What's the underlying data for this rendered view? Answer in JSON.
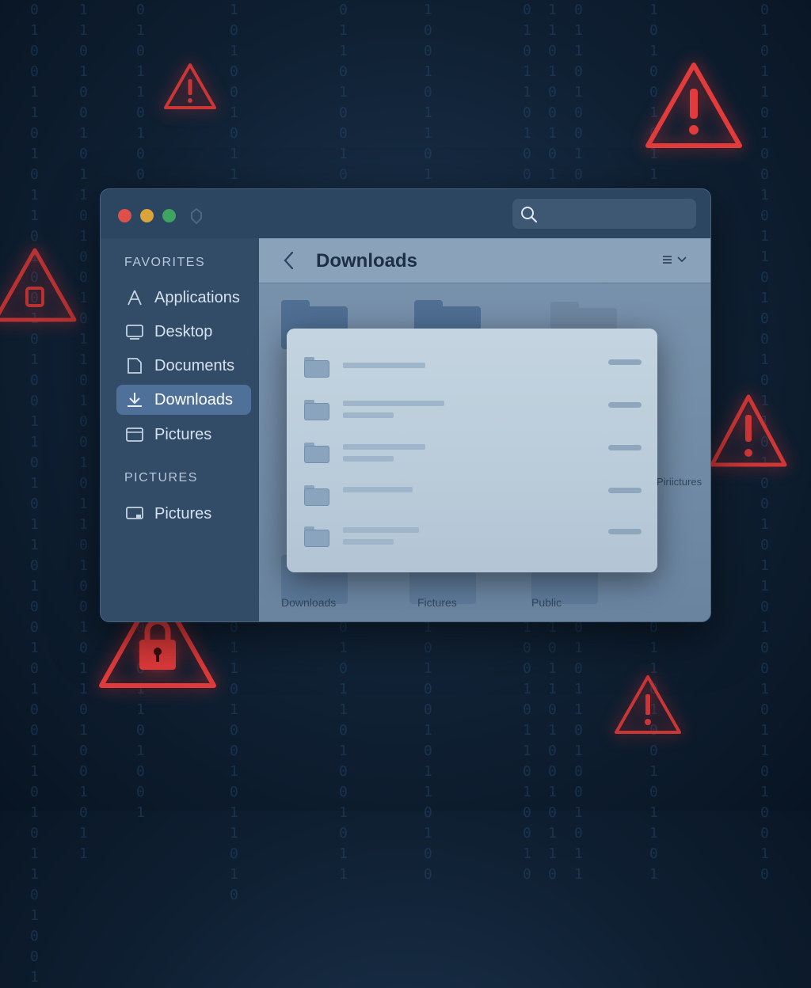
{
  "window": {
    "search_placeholder": "",
    "traffic_lights": [
      "#e0504a",
      "#d9a43a",
      "#3fa362"
    ]
  },
  "sidebar": {
    "favorites_title": "FAVORITES",
    "items": [
      {
        "label": "Applications",
        "icon": "applications-icon"
      },
      {
        "label": "Desktop",
        "icon": "desktop-icon"
      },
      {
        "label": "Documents",
        "icon": "document-icon"
      },
      {
        "label": "Downloads",
        "icon": "download-icon",
        "active": true
      },
      {
        "label": "Pictures",
        "icon": "pictures-icon"
      }
    ],
    "pictures_title": "PICTURES",
    "pictures_items": [
      {
        "label": "Pictures",
        "icon": "monitor-icon"
      }
    ]
  },
  "main": {
    "title": "Downloads",
    "view_icon": "list-view-icon",
    "background_labels": [
      "Downloads",
      "Fictures",
      "Public",
      "Piriictures"
    ]
  },
  "overlay": {
    "rows": 5
  },
  "colors": {
    "warning": "#e23b3b",
    "accent": "#4f7199",
    "background": "#0f2033"
  }
}
